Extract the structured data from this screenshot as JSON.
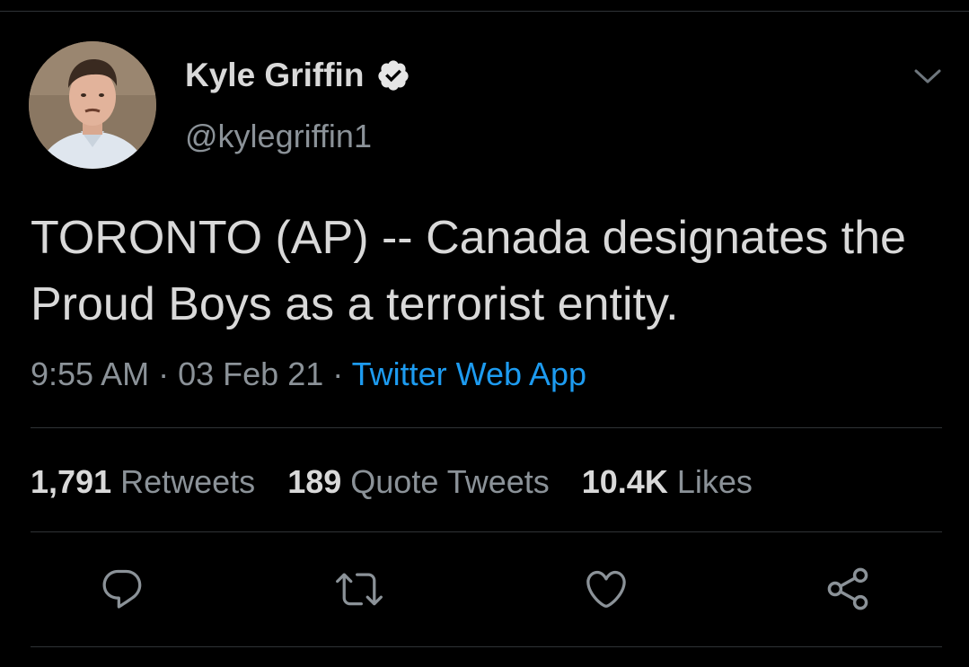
{
  "colors": {
    "background": "#000000",
    "text_primary": "#d9d9d9",
    "text_secondary": "#8b9298",
    "accent": "#1d9bf0",
    "divider": "#2f3336"
  },
  "author": {
    "display_name": "Kyle Griffin",
    "handle": "@kylegriffin1",
    "verified": true,
    "avatar_icon": "profile-photo"
  },
  "tweet": {
    "text": "TORONTO (AP) -- Canada designates the Proud Boys as a terrorist entity.",
    "time": "9:55 AM",
    "date": "03 Feb 21",
    "separator": "·",
    "source": "Twitter Web App"
  },
  "stats": [
    {
      "count": "1,791",
      "label": "Retweets"
    },
    {
      "count": "189",
      "label": "Quote Tweets"
    },
    {
      "count": "10.4K",
      "label": "Likes"
    }
  ],
  "actions": [
    {
      "name": "reply",
      "icon": "reply-icon"
    },
    {
      "name": "retweet",
      "icon": "retweet-icon"
    },
    {
      "name": "like",
      "icon": "heart-icon"
    },
    {
      "name": "share",
      "icon": "share-icon"
    }
  ],
  "menu_icon": "chevron-down-icon"
}
